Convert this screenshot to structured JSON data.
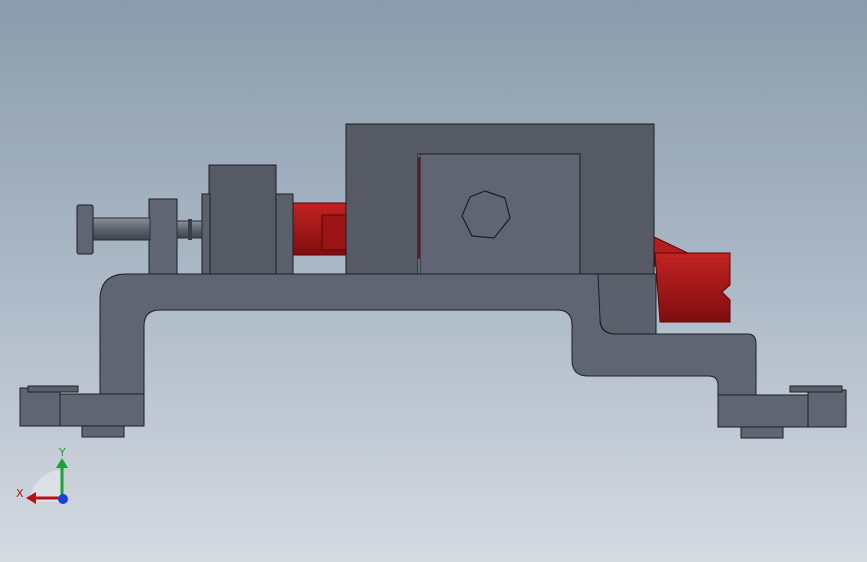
{
  "colors": {
    "background_top": "#8c9cac",
    "background_bottom": "#d6dbe2",
    "part_gray": "#5f6573",
    "part_gray_dark": "#4e535e",
    "part_gray_light": "#6a707d",
    "part_red": "#b01a1a",
    "part_red_dark": "#7a0c0c",
    "outline": "#1c1f24",
    "axis_x": "#b3141a",
    "axis_y": "#1fa13a",
    "axis_z": "#1a3fd6"
  },
  "triad": {
    "x_label": "X",
    "y_label": "Y"
  }
}
